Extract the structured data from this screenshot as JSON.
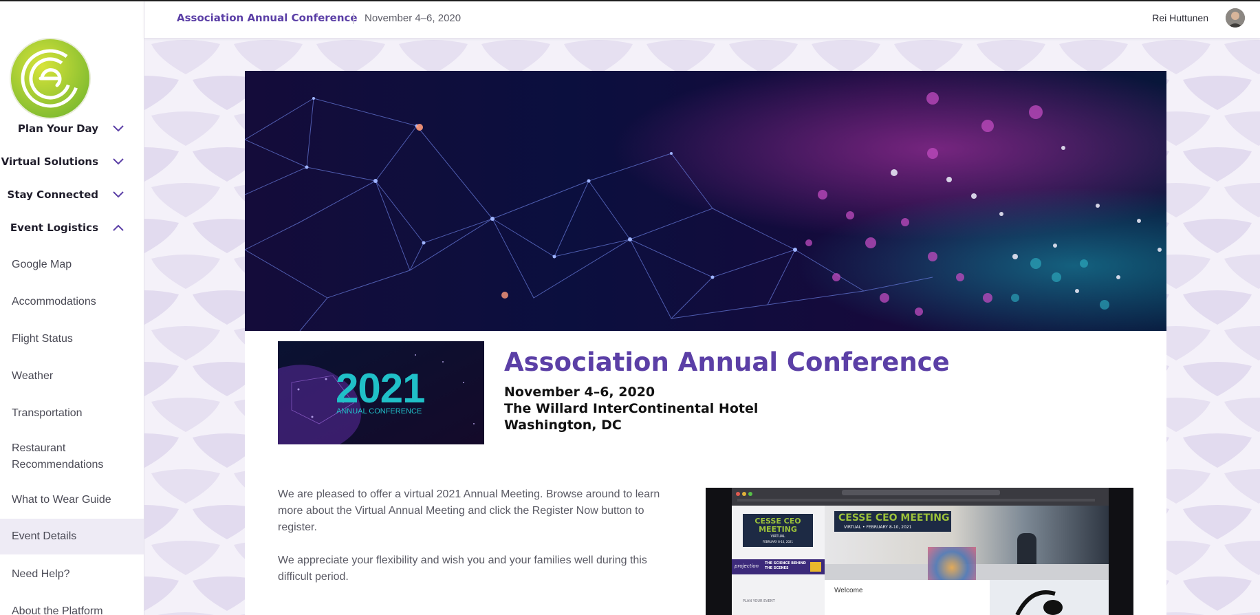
{
  "topbar": {
    "event_title": "Association Annual Conference",
    "separator": "|",
    "event_dates": "November 4–6, 2020",
    "user_name": "Rei Huttunen"
  },
  "sidebar": {
    "sections": [
      {
        "label": "Plan Your Day",
        "expanded": false
      },
      {
        "label": "Virtual Solutions",
        "expanded": false
      },
      {
        "label": "Stay Connected",
        "expanded": false
      },
      {
        "label": "Event Logistics",
        "expanded": true
      }
    ],
    "items": [
      {
        "label": "Google Map"
      },
      {
        "label": "Accommodations"
      },
      {
        "label": "Flight Status"
      },
      {
        "label": "Weather"
      },
      {
        "label": "Transportation"
      },
      {
        "label": "Restaurant Recommendations"
      },
      {
        "label": "What to Wear Guide"
      },
      {
        "label": "Event Details",
        "active": true
      },
      {
        "label": "Need Help?"
      },
      {
        "label": "About the Platform"
      }
    ]
  },
  "main": {
    "thumbnail": {
      "year": "2021",
      "subtitle": "ANNUAL CONFERENCE"
    },
    "title": "Association Annual Conference",
    "dates": "November 4–6, 2020",
    "venue": "The Willard InterContinental Hotel",
    "location": "Washington, DC",
    "paragraph1": "We are pleased to offer a virtual 2021 Annual Meeting. Browse around to learn more about the Virtual Annual Meeting and click the Register Now button to register.",
    "paragraph2": "We appreciate your flexibility and wish you and your families well during this difficult period.",
    "video": {
      "left_logo_title": "CESSE CEO MEETING",
      "left_logo_sub": "VIRTUAL",
      "left_logo_date": "FEBRUARY 8-10, 2021",
      "headline": "CESSE CEO MEETING",
      "headline_sub": "VIRTUAL • FEBRUARY 8-10, 2021",
      "promo_left": "projection",
      "promo_mid": "THE SCIENCE BEHIND THE SCENES",
      "welcome": "Welcome",
      "plan_label": "PLAN YOUR EVENT"
    }
  },
  "colors": {
    "brand_purple": "#5b3fa6",
    "logo_green": "#8cc63f",
    "active_item_bg": "#eeebf5",
    "pattern_bg": "#f2eff8"
  }
}
